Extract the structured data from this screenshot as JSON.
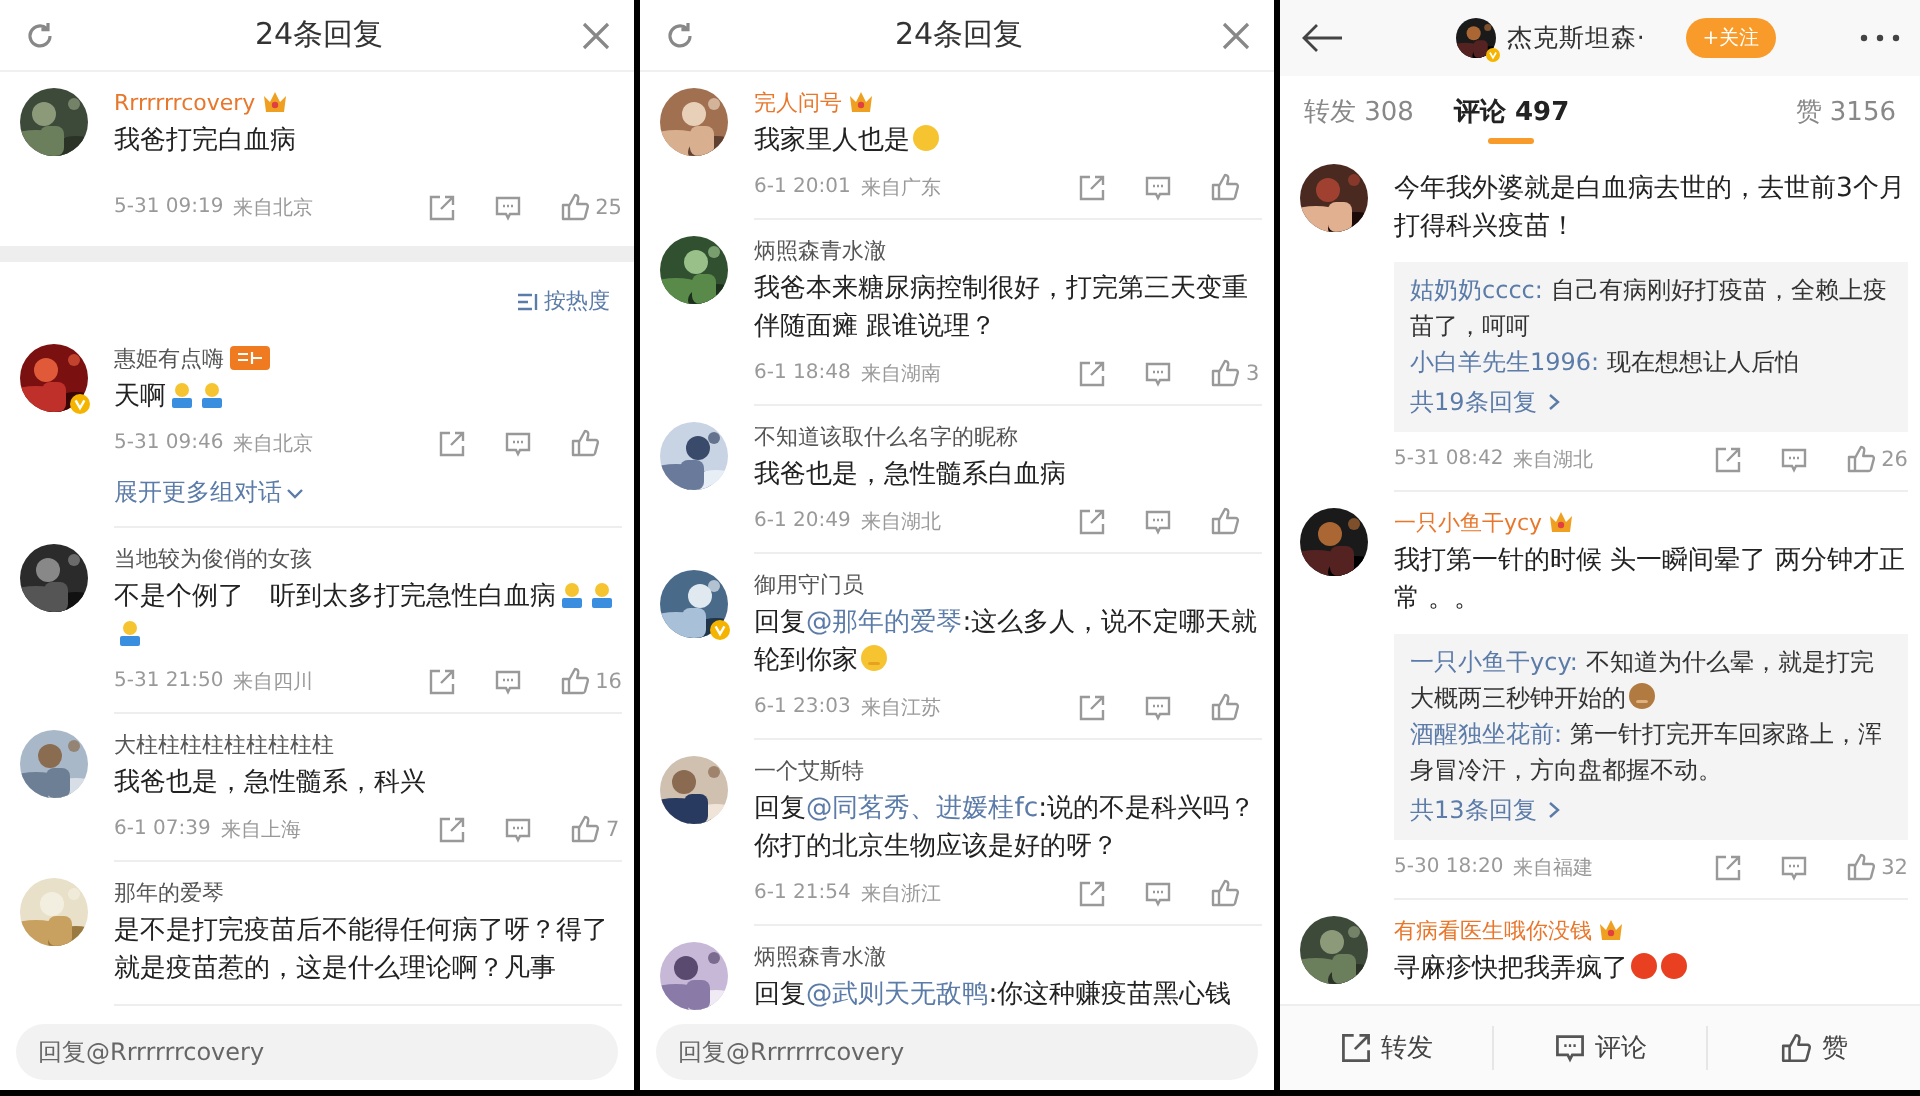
{
  "panels": [
    {
      "kind": "thread",
      "header": {
        "title": "24条回复"
      },
      "root": {
        "name": "Rrrrrrrcovery",
        "vip": true,
        "verified": false,
        "medal": false,
        "text": "我爸打完白血病",
        "time": "5-31 09:19",
        "location": "来自北京",
        "likes": "25"
      },
      "sort": {
        "label": "按热度"
      },
      "comments": [
        {
          "name": "惠姫有点嗨",
          "verified": true,
          "medal": true,
          "text": "天啊",
          "emojis": [
            {
              "kind": "person"
            },
            {
              "kind": "person"
            }
          ],
          "time": "5-31 09:46",
          "location": "来自北京",
          "expand": "展开更多组对话"
        },
        {
          "name": "当地较为俊俏的女孩",
          "verified": false,
          "medal": false,
          "text": "不是个例了　听到太多打完急性白血病",
          "emojis": [
            {
              "kind": "person"
            },
            {
              "kind": "person"
            },
            {
              "kind": "person"
            }
          ],
          "time": "5-31 21:50",
          "location": "来自四川",
          "likes": "16"
        },
        {
          "name": "大柱柱柱柱柱柱柱柱柱",
          "verified": false,
          "medal": false,
          "text": "我爸也是，急性髓系，科兴",
          "time": "6-1 07:39",
          "location": "来自上海",
          "likes": "7"
        },
        {
          "name": "那年的爱琴",
          "verified": false,
          "medal": false,
          "text": "是不是打完疫苗后不能得任何病了呀？得了就是疫苗惹的，这是什么理论啊？凡事"
        }
      ],
      "reply_field": {
        "placeholder": "回复@Rrrrrrrcovery"
      }
    },
    {
      "kind": "thread",
      "header": {
        "title": "24条回复"
      },
      "comments": [
        {
          "name": "完人问号",
          "vip": true,
          "verified": false,
          "medal": false,
          "text": "我家里人也是",
          "emojis": [
            {
              "kind": "smile"
            }
          ],
          "time": "6-1 20:01",
          "location": "来自广东"
        },
        {
          "name": "炳照森青水澈",
          "verified": false,
          "medal": false,
          "text": "我爸本来糖尿病控制很好，打完第三天变重伴随面瘫 跟谁说理？",
          "time": "6-1 18:48",
          "location": "来自湖南",
          "likes": "3"
        },
        {
          "name": "不知道该取什么名字的昵称",
          "verified": false,
          "medal": false,
          "text": "我爸也是，急性髓系白血病",
          "time": "6-1 20:49",
          "location": "来自湖北"
        },
        {
          "name": "御用守门员",
          "verified": true,
          "medal": false,
          "prefix": "回复",
          "mention": "@那年的爱琴",
          "text": ":这么多人，说不定哪天就轮到你家",
          "emojis": [
            {
              "kind": "grin"
            }
          ],
          "time": "6-1 23:03",
          "location": "来自江苏"
        },
        {
          "name": "一个艾斯特",
          "verified": false,
          "medal": false,
          "prefix": "回复",
          "mention": "@同茗秀、进媛桂fc",
          "text": ":说的不是科兴吗？你打的北京生物应该是好的呀？",
          "time": "6-1 21:54",
          "location": "来自浙江"
        },
        {
          "name": "炳照森青水澈",
          "verified": false,
          "medal": false,
          "prefix": "回复",
          "mention": "@武则天无敌鸭",
          "text": ":你这种赚疫苗黑心钱"
        }
      ],
      "reply_field": {
        "placeholder": "回复@Rrrrrrrcovery"
      }
    },
    {
      "kind": "post",
      "author": {
        "name": "杰克斯坦森·",
        "verified": true,
        "follow": "+关注"
      },
      "tabs": [
        {
          "label": "转发 308",
          "selected": false
        },
        {
          "label": "评论 497",
          "selected": true
        },
        {
          "label": "赞 3156",
          "selected": false
        }
      ],
      "comments": [
        {
          "verified": false,
          "medal": false,
          "text": "今年我外婆就是白血病去世的，去世前3个月打得科兴疫苗！",
          "replies": [
            {
              "name": "姑奶奶cccc:",
              "text": "自己有病刚好打疫苗，全赖上疫苗了，呵呵"
            },
            {
              "name": "小白羊先生1996:",
              "text": "现在想想让人后怕"
            }
          ],
          "more": "共19条回复",
          "time": "5-31 08:42",
          "location": "来自湖北",
          "likes": "26"
        },
        {
          "name": "一只小鱼干ycy",
          "vip": true,
          "verified": false,
          "medal": false,
          "text": "我打第一针的时候 头一瞬间晕了 两分钟才正常 。。",
          "replies": [
            {
              "name": "一只小鱼干ycy:",
              "text": "不知道为什么晕，就是打完大概两三秒钟开始的",
              "emojis": [
                {
                  "kind": "monkey"
                }
              ]
            },
            {
              "name": "酒醒独坐花前:",
              "text": "第一针打完开车回家路上，浑身冒冷汗，方向盘都握不动。"
            }
          ],
          "more": "共13条回复",
          "time": "5-30 18:20",
          "location": "来自福建",
          "likes": "32"
        },
        {
          "name": "有病看医生哦你没钱",
          "vip": true,
          "verified": false,
          "medal": false,
          "text": "寻麻疹快把我弄疯了",
          "emojis": [
            {
              "kind": "angry"
            },
            {
              "kind": "angry"
            }
          ]
        }
      ],
      "actions": [
        {
          "kind": "share",
          "label": "转发"
        },
        {
          "kind": "comment",
          "label": "评论"
        },
        {
          "kind": "like",
          "label": "赞"
        }
      ]
    }
  ]
}
